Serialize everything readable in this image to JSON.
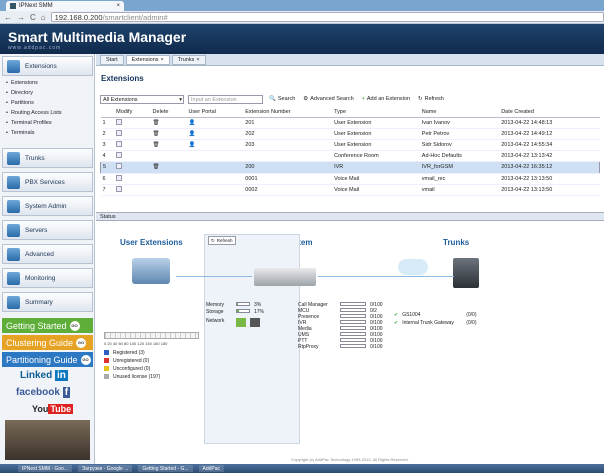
{
  "browser": {
    "tab_title": "IPNext SMM",
    "url_host": "192.168.0.200",
    "url_path": "/smartclient/admin#"
  },
  "app": {
    "title": "Smart Multimedia Manager",
    "subtitle": "www.addpac.com"
  },
  "sidebar": {
    "sections": [
      "Extensions",
      "Trunks",
      "PBX Services",
      "System Admin",
      "Servers",
      "Advanced",
      "Monitoring",
      "Summary"
    ],
    "sub_items": [
      "Extensions",
      "Directory",
      "Partitions",
      "Routing Access Lists",
      "Terminal Profiles",
      "Terminals"
    ],
    "guides": [
      "Getting Started",
      "Clustering Guide",
      "Partitioning Guide"
    ],
    "go": "GO",
    "social": {
      "linkedin": "Linked",
      "linkedin_in": "in",
      "facebook": "facebook",
      "f": "f",
      "youtube_you": "You",
      "youtube_tube": "Tube"
    }
  },
  "tabs": [
    "Start",
    "Extensions",
    "Trunks"
  ],
  "extensions": {
    "title": "Extensions",
    "filter_value": "All Extensions",
    "search_placeholder": "Input an Extension",
    "buttons": [
      "Search",
      "Advanced Search",
      "Add an Extension",
      "Refresh"
    ],
    "columns": [
      "",
      "Modify",
      "Delete",
      "User Portal",
      "Extension Number",
      "Type",
      "Name",
      "Date Created"
    ],
    "rows": [
      [
        "1",
        "201",
        "User Extension",
        "Ivan Ivanov",
        "2013-04-22 14:48:13"
      ],
      [
        "2",
        "202",
        "User Extension",
        "Petr Petrov",
        "2013-04-22 14:49:12"
      ],
      [
        "3",
        "203",
        "User Extension",
        "Sidr Sidorov",
        "2013-04-22 14:55:34"
      ],
      [
        "4",
        "",
        "Conference Room",
        "Ad-Hoc Defaults",
        "2013-04-22 13:13:42"
      ],
      [
        "5",
        "200",
        "IVR",
        "IVR_forGSM",
        "2013-04-22 16:35:12"
      ],
      [
        "6",
        "0001",
        "Voice Mail",
        "vmail_rec",
        "2013-04-22 13:13:50"
      ],
      [
        "7",
        "0002",
        "Voice Mail",
        "vmail",
        "2013-04-22 13:13:50"
      ]
    ]
  },
  "status": {
    "tab": "Status",
    "user_extensions": "User Extensions",
    "system": "System",
    "trunks": "Trunks",
    "refresh": "Refresh",
    "scale": "0 20 40 60 80 100 120 140 160 180",
    "legend": [
      "Registered (3)",
      "Unregistered (0)",
      "Unconfigured (0)",
      "Unused license (197)"
    ],
    "legend_colors": [
      "#2f5fc0",
      "#d33",
      "#e6c21a",
      "#aaa"
    ],
    "resources": [
      {
        "label": "Memory",
        "value": "3%",
        "level": 0.03
      },
      {
        "label": "Storage",
        "value": "17%",
        "level": 0.17
      },
      {
        "label": "Network",
        "value": "",
        "level": 0
      }
    ],
    "servers": [
      {
        "label": "Call Manager",
        "value": "0/100"
      },
      {
        "label": "MCU",
        "value": "0/2"
      },
      {
        "label": "Presence",
        "value": "0/100"
      },
      {
        "label": "IVR",
        "value": "0/100"
      },
      {
        "label": "Media",
        "value": "0/100"
      },
      {
        "label": "UMS",
        "value": "0/100"
      },
      {
        "label": "PTT",
        "value": "0/100"
      },
      {
        "label": "RtpProxy",
        "value": "0/100"
      }
    ],
    "trunk_list": [
      {
        "name": "GS1004",
        "count": "(0/0)"
      },
      {
        "name": "Internal Trunk Gateway",
        "count": "(0/0)"
      }
    ]
  },
  "footer": "Copyright (c) AddPac Technology 1999-2013, All Rights Reserved.",
  "taskbar": [
    "IPNext SMM - Goo...",
    "Загрузки - Google ...",
    "Getting Started - G...",
    "AddPac"
  ]
}
